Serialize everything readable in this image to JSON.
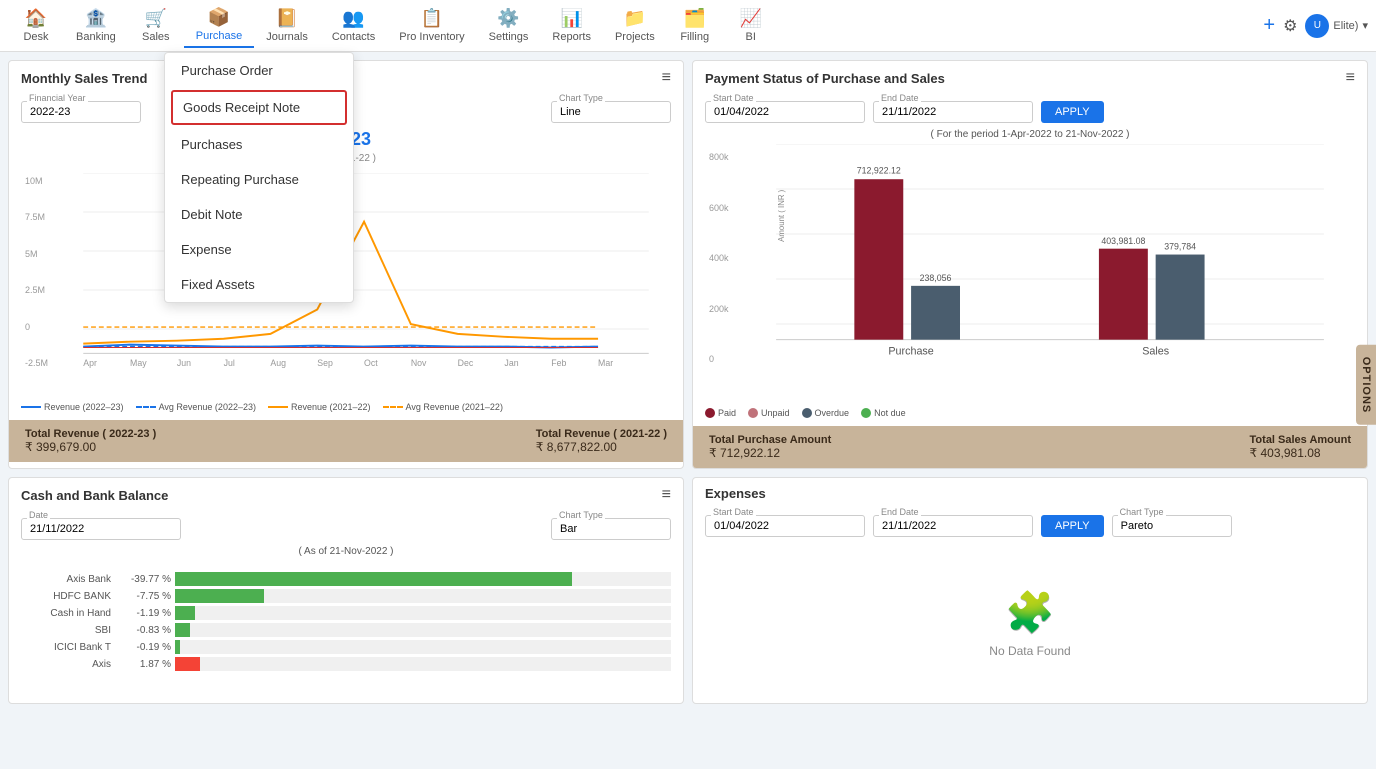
{
  "nav": {
    "items": [
      {
        "id": "desk",
        "label": "Desk",
        "icon": "🏠",
        "active": false
      },
      {
        "id": "banking",
        "label": "Banking",
        "icon": "🏦",
        "active": false
      },
      {
        "id": "sales",
        "label": "Sales",
        "icon": "🛒",
        "active": false
      },
      {
        "id": "purchase",
        "label": "Purchase",
        "icon": "📦",
        "active": true
      },
      {
        "id": "journals",
        "label": "Journals",
        "icon": "📔",
        "active": false
      },
      {
        "id": "contacts",
        "label": "Contacts",
        "icon": "👥",
        "active": false
      },
      {
        "id": "pro-inventory",
        "label": "Pro Inventory",
        "icon": "📋",
        "active": false
      },
      {
        "id": "settings",
        "label": "Settings",
        "icon": "⚙️",
        "active": false
      },
      {
        "id": "reports",
        "label": "Reports",
        "icon": "📊",
        "active": false
      },
      {
        "id": "projects",
        "label": "Projects",
        "icon": "📁",
        "active": false
      },
      {
        "id": "filling",
        "label": "Filling",
        "icon": "🗂️",
        "active": false
      },
      {
        "id": "bi",
        "label": "BI",
        "icon": "📈",
        "active": false
      }
    ],
    "user_label": "Elite)",
    "dropdown_chevron": "▾"
  },
  "purchase_dropdown": {
    "title": "Purchase Order",
    "items": [
      {
        "id": "purchase-order",
        "label": "Purchase Order",
        "highlighted": false
      },
      {
        "id": "goods-receipt-note",
        "label": "Goods Receipt Note",
        "highlighted": true
      },
      {
        "id": "purchases",
        "label": "Purchases",
        "highlighted": false
      },
      {
        "id": "repeating-purchase",
        "label": "Repeating Purchase",
        "highlighted": false
      },
      {
        "id": "debit-note",
        "label": "Debit Note",
        "highlighted": false
      },
      {
        "id": "expense",
        "label": "Expense",
        "highlighted": false
      },
      {
        "id": "fixed-assets",
        "label": "Fixed Assets",
        "highlighted": false
      }
    ]
  },
  "monthly_sales": {
    "title": "Monthly Sales Trend",
    "financial_year_label": "Financial Year",
    "financial_year_value": "2022-23",
    "chart_type_label": "Chart Type",
    "chart_type_value": "Line",
    "highlight_year": "22–23",
    "highlight_compare": "to ( 2021-22 )",
    "period_note": "",
    "menu_icon": "≡",
    "y_labels": [
      "10M",
      "7.5M",
      "5M",
      "2.5M",
      "0",
      "-2.5M"
    ],
    "x_labels": [
      "Apr",
      "May",
      "Jun",
      "Jul",
      "Aug",
      "Sep",
      "Oct",
      "Nov",
      "Dec",
      "Jan",
      "Feb",
      "Mar"
    ],
    "legend": [
      {
        "label": "Revenue (2022-23)",
        "color": "#1a73e8",
        "style": "solid"
      },
      {
        "label": "Avg Revenue (2022-23)",
        "color": "#1a73e8",
        "style": "dashed"
      },
      {
        "label": "Revenue (2021-22)",
        "color": "#ff9800",
        "style": "solid"
      },
      {
        "label": "Avg Revenue (2021-22)",
        "color": "#ff9800",
        "style": "dashed"
      }
    ]
  },
  "monthly_stats": {
    "total_revenue_2223_label": "Total Revenue ( 2022-23 )",
    "total_revenue_2223_value": "₹ 399,679.00",
    "total_revenue_2122_label": "Total Revenue ( 2021-22 )",
    "total_revenue_2122_value": "₹ 8,677,822.00"
  },
  "payment_status": {
    "title": "Payment Status of Purchase and Sales",
    "start_date_label": "Start Date",
    "start_date_value": "01/04/2022",
    "end_date_label": "End Date",
    "end_date_value": "21/11/2022",
    "apply_label": "APPLY",
    "period_note": "( For the period 1-Apr-2022 to 21-Nov-2022 )",
    "menu_icon": "≡",
    "y_labels": [
      "800k",
      "600k",
      "400k",
      "200k",
      "0"
    ],
    "purchase_paid": 712922.12,
    "purchase_unpaid": 238056,
    "sales_paid": 403981.08,
    "sales_unpaid": 379784,
    "bars": [
      {
        "group": "Purchase",
        "paid": 712922.12,
        "unpaid": 238056,
        "overdue": 0,
        "notdue": 0
      },
      {
        "group": "Sales",
        "paid": 403981.08,
        "unpaid": 0,
        "overdue": 0,
        "notdue": 379784
      }
    ],
    "legend": [
      {
        "label": "Paid",
        "color": "#8b1a2e"
      },
      {
        "label": "Unpaid",
        "color": "#c0727a"
      },
      {
        "label": "Overdue",
        "color": "#4a5d6e"
      },
      {
        "label": "Not due",
        "color": "#4caf50"
      }
    ]
  },
  "payment_stats": {
    "total_purchase_label": "Total Purchase Amount",
    "total_purchase_value": "₹ 712,922.12",
    "total_sales_label": "Total Sales Amount",
    "total_sales_value": "₹ 403,981.08"
  },
  "cash_bank": {
    "title": "Cash and Bank Balance",
    "date_label": "Date",
    "date_value": "21/11/2022",
    "chart_type_label": "Chart Type",
    "chart_type_value": "Bar",
    "period_note": "( As of 21-Nov-2022 )",
    "menu_icon": "≡",
    "rows": [
      {
        "label": "Axis Bank",
        "pct": -39.77,
        "pct_display": "-39.77 %"
      },
      {
        "label": "HDFC BANK",
        "pct": -7.75,
        "pct_display": "-7.75 %"
      },
      {
        "label": "Cash in Hand",
        "pct": -1.19,
        "pct_display": "-1.19 %"
      },
      {
        "label": "SBI",
        "pct": -0.83,
        "pct_display": "-0.83 %"
      },
      {
        "label": "ICICI Bank T",
        "pct": -0.19,
        "pct_display": "-0.19 %"
      },
      {
        "label": "Axis",
        "pct": 1.87,
        "pct_display": "1.87 %"
      }
    ]
  },
  "expenses": {
    "title": "Expenses",
    "start_date_label": "Start Date",
    "start_date_value": "01/04/2022",
    "end_date_label": "End Date",
    "end_date_value": "21/11/2022",
    "apply_label": "APPLY",
    "chart_type_label": "Chart Type",
    "chart_type_value": "Pareto",
    "no_data_text": "No Data Found",
    "no_data_icon": "🧩"
  },
  "options_tab": "OPTIONS"
}
